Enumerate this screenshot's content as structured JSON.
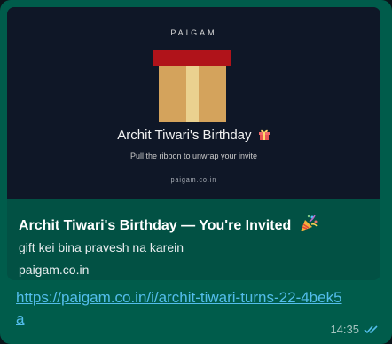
{
  "preview": {
    "brand": "PAIGAM",
    "title": "Archit Tiwari's Birthday",
    "subtitle": "Pull the ribbon to unwrap your invite",
    "domain": "paigam.co.in"
  },
  "link_card": {
    "title": "Archit Tiwari's Birthday — You're Invited",
    "description": "gift kei bina pravesh na karein",
    "domain": "paigam.co.in"
  },
  "message": {
    "url": "https://paigam.co.in/i/archit-tiwari-turns-22-4bek5a",
    "time": "14:35",
    "status": "read"
  },
  "icons": {
    "gift": "gift-icon",
    "party": "party-popper-icon",
    "read_receipt": "double-check-icon"
  },
  "colors": {
    "bubble": "#005c4b",
    "card": "#025144",
    "preview_bg": "#0f1727",
    "link": "#53bdeb",
    "read_tick": "#53bdeb"
  }
}
